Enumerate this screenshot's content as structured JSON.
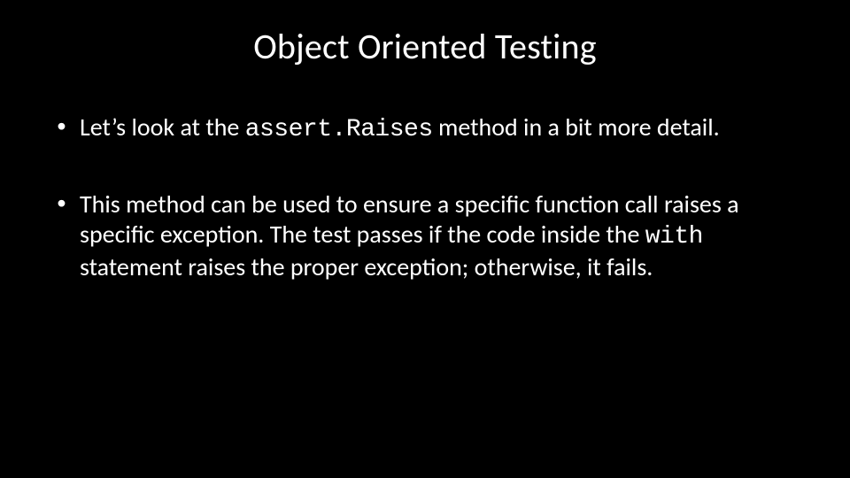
{
  "title": "Object Oriented Testing",
  "bullets": [
    {
      "prefix": "Let’s look at the ",
      "code": "assert.Raises",
      "suffix": " method in a bit more detail."
    },
    {
      "prefix": "This method can be used to ensure a specific function call raises a specific exception. The test passes if the code inside the ",
      "code": "with",
      "suffix": " statement raises the proper exception; otherwise, it fails."
    }
  ]
}
